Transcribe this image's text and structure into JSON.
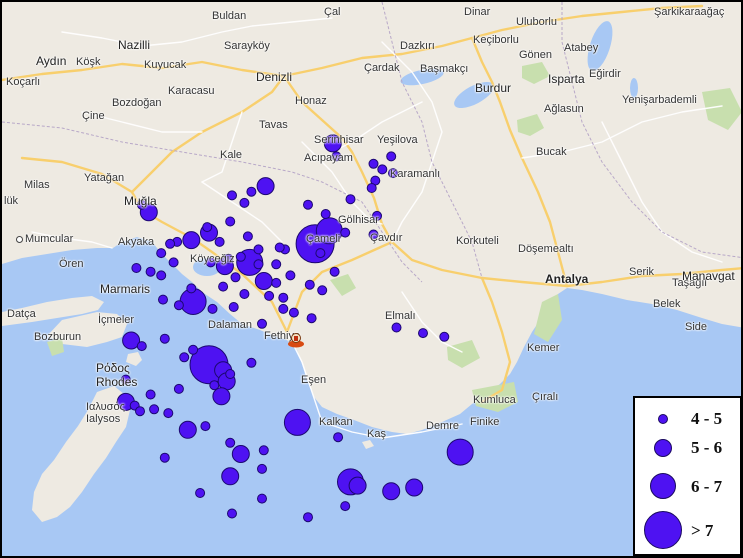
{
  "colors": {
    "land": "#eeeae2",
    "water": "#a8c8f4",
    "park": "#c8dfae",
    "road_major": "#f8cf6d",
    "road_minor": "#ffffff",
    "quake": "#4e12f2",
    "quake_outline": "#1c0870"
  },
  "places": [
    {
      "name": "Buldan"
    },
    {
      "name": "Çal"
    },
    {
      "name": "Dinar"
    },
    {
      "name": "Uluborlu"
    },
    {
      "name": "Şarkikaraağaç"
    },
    {
      "name": "Nazilli"
    },
    {
      "name": "Sarayköy"
    },
    {
      "name": "Dazkırı"
    },
    {
      "name": "Keçiborlu"
    },
    {
      "name": "Gönen"
    },
    {
      "name": "Atabey"
    },
    {
      "name": "Aydın"
    },
    {
      "name": "Köşk"
    },
    {
      "name": "Kuyucak"
    },
    {
      "name": "Denizli"
    },
    {
      "name": "Çardak"
    },
    {
      "name": "Başmakçı"
    },
    {
      "name": "Isparta"
    },
    {
      "name": "Eğirdir"
    },
    {
      "name": "Koçarlı"
    },
    {
      "name": "Karacasu"
    },
    {
      "name": "Honaz"
    },
    {
      "name": "Burdur"
    },
    {
      "name": "Ağlasun"
    },
    {
      "name": "Yenişarbademli"
    },
    {
      "name": "Bozdoğan"
    },
    {
      "name": "Çine"
    },
    {
      "name": "Tavas"
    },
    {
      "name": "Serinhisar"
    },
    {
      "name": "Yeşilova"
    },
    {
      "name": "Kale"
    },
    {
      "name": "Acıpayam"
    },
    {
      "name": "Bucak"
    },
    {
      "name": "Karamanlı"
    },
    {
      "name": "Yatağan"
    },
    {
      "name": "Milas"
    },
    {
      "name": "Muğla"
    },
    {
      "name": "lük"
    },
    {
      "name": "Gölhisar"
    },
    {
      "name": "Mumcular"
    },
    {
      "name": "Akyaka"
    },
    {
      "name": "Çavdır"
    },
    {
      "name": "Korkuteli"
    },
    {
      "name": "Döşemealtı"
    },
    {
      "name": "Ören"
    },
    {
      "name": "Köyceğiz"
    },
    {
      "name": "Çameli"
    },
    {
      "name": "Antalya"
    },
    {
      "name": "Serik"
    },
    {
      "name": "Taşağıl"
    },
    {
      "name": "Manavgat"
    },
    {
      "name": "Marmaris"
    },
    {
      "name": "Belek"
    },
    {
      "name": "Side"
    },
    {
      "name": "Datça"
    },
    {
      "name": "İçmeler"
    },
    {
      "name": "Dalaman"
    },
    {
      "name": "Elmalı"
    },
    {
      "name": "Bozburun"
    },
    {
      "name": "Fethiye"
    },
    {
      "name": "Kemer"
    },
    {
      "name": "Ρόδος"
    },
    {
      "name": "Rhodes"
    },
    {
      "name": "Eşen"
    },
    {
      "name": "Çıralı"
    },
    {
      "name": "Kumluca"
    },
    {
      "name": "Ιαλυσός"
    },
    {
      "name": "Ialysos"
    },
    {
      "name": "Kalkan"
    },
    {
      "name": "Kaş"
    },
    {
      "name": "Demre"
    },
    {
      "name": "Finike"
    }
  ],
  "legend": {
    "items": [
      {
        "label": "4 - 5",
        "magnitude_class": 1
      },
      {
        "label": "5 - 6",
        "magnitude_class": 2
      },
      {
        "label": "6 - 7",
        "magnitude_class": 3
      },
      {
        "label": "> 7",
        "magnitude_class": 4
      }
    ]
  },
  "earthquakes": [
    {
      "lat": 37.49,
      "lon": 29.42,
      "mag_class": 2
    },
    {
      "lat": 37.42,
      "lon": 29.44,
      "mag_class": 1
    },
    {
      "lat": 37.42,
      "lon": 29.75,
      "mag_class": 1
    },
    {
      "lat": 37.38,
      "lon": 29.65,
      "mag_class": 1
    },
    {
      "lat": 37.33,
      "lon": 29.76,
      "mag_class": 1
    },
    {
      "lat": 37.29,
      "lon": 29.66,
      "mag_class": 1
    },
    {
      "lat": 37.25,
      "lon": 29.64,
      "mag_class": 1
    },
    {
      "lat": 37.19,
      "lon": 29.52,
      "mag_class": 1
    },
    {
      "lat": 37.11,
      "lon": 29.38,
      "mag_class": 1
    },
    {
      "lat": 37.1,
      "lon": 29.67,
      "mag_class": 1
    },
    {
      "lat": 37.02,
      "lon": 29.4,
      "mag_class": 3
    },
    {
      "lat": 37.01,
      "lon": 29.49,
      "mag_class": 1
    },
    {
      "lat": 37.0,
      "lon": 29.65,
      "mag_class": 1
    },
    {
      "lat": 37.26,
      "lon": 29.04,
      "mag_class": 2
    },
    {
      "lat": 37.23,
      "lon": 28.96,
      "mag_class": 1
    },
    {
      "lat": 37.21,
      "lon": 28.85,
      "mag_class": 1
    },
    {
      "lat": 37.17,
      "lon": 28.92,
      "mag_class": 1
    },
    {
      "lat": 37.16,
      "lon": 28.34,
      "mag_class": 1
    },
    {
      "lat": 37.12,
      "lon": 28.38,
      "mag_class": 2
    },
    {
      "lat": 37.07,
      "lon": 28.84,
      "mag_class": 1
    },
    {
      "lat": 37.01,
      "lon": 28.72,
      "mag_class": 2
    },
    {
      "lat": 36.97,
      "lon": 28.62,
      "mag_class": 2
    },
    {
      "lat": 36.96,
      "lon": 28.54,
      "mag_class": 1
    },
    {
      "lat": 36.92,
      "lon": 29.0,
      "mag_class": 1
    },
    {
      "lat": 36.92,
      "lon": 29.15,
      "mag_class": 1
    },
    {
      "lat": 36.95,
      "lon": 29.32,
      "mag_class": 4
    },
    {
      "lat": 36.93,
      "lon": 29.12,
      "mag_class": 1
    },
    {
      "lat": 36.96,
      "lon": 28.78,
      "mag_class": 1
    },
    {
      "lat": 36.95,
      "lon": 28.5,
      "mag_class": 1
    },
    {
      "lat": 36.9,
      "lon": 28.45,
      "mag_class": 1
    },
    {
      "lat": 36.88,
      "lon": 28.9,
      "mag_class": 1
    },
    {
      "lat": 36.87,
      "lon": 28.83,
      "mag_class": 1
    },
    {
      "lat": 36.85,
      "lon": 28.52,
      "mag_class": 1
    },
    {
      "lat": 36.85,
      "lon": 28.73,
      "mag_class": 1
    },
    {
      "lat": 36.85,
      "lon": 28.95,
      "mag_class": 3
    },
    {
      "lat": 36.84,
      "lon": 29.0,
      "mag_class": 1
    },
    {
      "lat": 36.84,
      "lon": 29.1,
      "mag_class": 1
    },
    {
      "lat": 36.83,
      "lon": 28.81,
      "mag_class": 2
    },
    {
      "lat": 36.82,
      "lon": 28.31,
      "mag_class": 1
    },
    {
      "lat": 36.8,
      "lon": 28.39,
      "mag_class": 1
    },
    {
      "lat": 36.8,
      "lon": 29.43,
      "mag_class": 1
    },
    {
      "lat": 36.78,
      "lon": 28.45,
      "mag_class": 1
    },
    {
      "lat": 36.77,
      "lon": 28.87,
      "mag_class": 1
    },
    {
      "lat": 36.75,
      "lon": 29.03,
      "mag_class": 2
    },
    {
      "lat": 36.74,
      "lon": 29.1,
      "mag_class": 1
    },
    {
      "lat": 36.73,
      "lon": 29.29,
      "mag_class": 1
    },
    {
      "lat": 36.72,
      "lon": 28.8,
      "mag_class": 1
    },
    {
      "lat": 36.71,
      "lon": 28.62,
      "mag_class": 1
    },
    {
      "lat": 36.7,
      "lon": 29.36,
      "mag_class": 1
    },
    {
      "lat": 36.68,
      "lon": 28.92,
      "mag_class": 1
    },
    {
      "lat": 36.67,
      "lon": 29.06,
      "mag_class": 1
    },
    {
      "lat": 36.66,
      "lon": 29.14,
      "mag_class": 1
    },
    {
      "lat": 36.65,
      "lon": 28.46,
      "mag_class": 1
    },
    {
      "lat": 36.64,
      "lon": 28.63,
      "mag_class": 3
    },
    {
      "lat": 36.62,
      "lon": 28.55,
      "mag_class": 1
    },
    {
      "lat": 36.61,
      "lon": 28.86,
      "mag_class": 1
    },
    {
      "lat": 36.6,
      "lon": 28.74,
      "mag_class": 1
    },
    {
      "lat": 36.6,
      "lon": 29.14,
      "mag_class": 1
    },
    {
      "lat": 36.58,
      "lon": 29.2,
      "mag_class": 1
    },
    {
      "lat": 36.55,
      "lon": 29.3,
      "mag_class": 1
    },
    {
      "lat": 36.52,
      "lon": 29.02,
      "mag_class": 1
    },
    {
      "lat": 36.5,
      "lon": 29.78,
      "mag_class": 1
    },
    {
      "lat": 36.47,
      "lon": 29.93,
      "mag_class": 1
    },
    {
      "lat": 36.45,
      "lon": 30.05,
      "mag_class": 1
    },
    {
      "lat": 36.43,
      "lon": 28.28,
      "mag_class": 2
    },
    {
      "lat": 36.4,
      "lon": 28.34,
      "mag_class": 1
    },
    {
      "lat": 36.38,
      "lon": 28.63,
      "mag_class": 1
    },
    {
      "lat": 36.34,
      "lon": 28.58,
      "mag_class": 1
    },
    {
      "lat": 36.31,
      "lon": 28.96,
      "mag_class": 1
    },
    {
      "lat": 36.3,
      "lon": 28.72,
      "mag_class": 4
    },
    {
      "lat": 36.27,
      "lon": 28.8,
      "mag_class": 2
    },
    {
      "lat": 36.25,
      "lon": 28.84,
      "mag_class": 1
    },
    {
      "lat": 36.22,
      "lon": 28.25,
      "mag_class": 1
    },
    {
      "lat": 36.21,
      "lon": 28.82,
      "mag_class": 2
    },
    {
      "lat": 36.19,
      "lon": 28.75,
      "mag_class": 1
    },
    {
      "lat": 36.17,
      "lon": 28.55,
      "mag_class": 1
    },
    {
      "lat": 36.14,
      "lon": 28.39,
      "mag_class": 1
    },
    {
      "lat": 36.13,
      "lon": 28.79,
      "mag_class": 2
    },
    {
      "lat": 36.1,
      "lon": 28.25,
      "mag_class": 2
    },
    {
      "lat": 36.08,
      "lon": 28.3,
      "mag_class": 1
    },
    {
      "lat": 36.06,
      "lon": 28.41,
      "mag_class": 1
    },
    {
      "lat": 36.05,
      "lon": 28.33,
      "mag_class": 1
    },
    {
      "lat": 36.04,
      "lon": 28.49,
      "mag_class": 1
    },
    {
      "lat": 35.99,
      "lon": 29.22,
      "mag_class": 3
    },
    {
      "lat": 35.97,
      "lon": 28.7,
      "mag_class": 1
    },
    {
      "lat": 35.95,
      "lon": 28.6,
      "mag_class": 2
    },
    {
      "lat": 35.91,
      "lon": 29.45,
      "mag_class": 1
    },
    {
      "lat": 35.88,
      "lon": 28.84,
      "mag_class": 1
    },
    {
      "lat": 35.84,
      "lon": 29.03,
      "mag_class": 1
    },
    {
      "lat": 35.83,
      "lon": 30.14,
      "mag_class": 3
    },
    {
      "lat": 35.82,
      "lon": 28.9,
      "mag_class": 2
    },
    {
      "lat": 35.8,
      "lon": 28.47,
      "mag_class": 1
    },
    {
      "lat": 35.74,
      "lon": 29.02,
      "mag_class": 1
    },
    {
      "lat": 35.7,
      "lon": 28.84,
      "mag_class": 2
    },
    {
      "lat": 35.67,
      "lon": 29.52,
      "mag_class": 3
    },
    {
      "lat": 35.65,
      "lon": 29.56,
      "mag_class": 2
    },
    {
      "lat": 35.64,
      "lon": 29.88,
      "mag_class": 2
    },
    {
      "lat": 35.62,
      "lon": 29.75,
      "mag_class": 2
    },
    {
      "lat": 35.61,
      "lon": 28.67,
      "mag_class": 1
    },
    {
      "lat": 35.58,
      "lon": 29.02,
      "mag_class": 1
    },
    {
      "lat": 35.54,
      "lon": 29.49,
      "mag_class": 1
    },
    {
      "lat": 35.5,
      "lon": 28.85,
      "mag_class": 1
    },
    {
      "lat": 35.48,
      "lon": 29.28,
      "mag_class": 1
    },
    {
      "lat": 37.35,
      "lon": 29.7,
      "mag_class": 1
    },
    {
      "lat": 37.16,
      "lon": 29.28,
      "mag_class": 1
    },
    {
      "lat": 37.04,
      "lon": 28.71,
      "mag_class": 1
    },
    {
      "lat": 36.99,
      "lon": 28.94,
      "mag_class": 1
    },
    {
      "lat": 36.9,
      "lon": 29.35,
      "mag_class": 1
    },
    {
      "lat": 36.78,
      "lon": 29.18,
      "mag_class": 1
    },
    {
      "lat": 36.44,
      "lon": 28.47,
      "mag_class": 1
    }
  ]
}
